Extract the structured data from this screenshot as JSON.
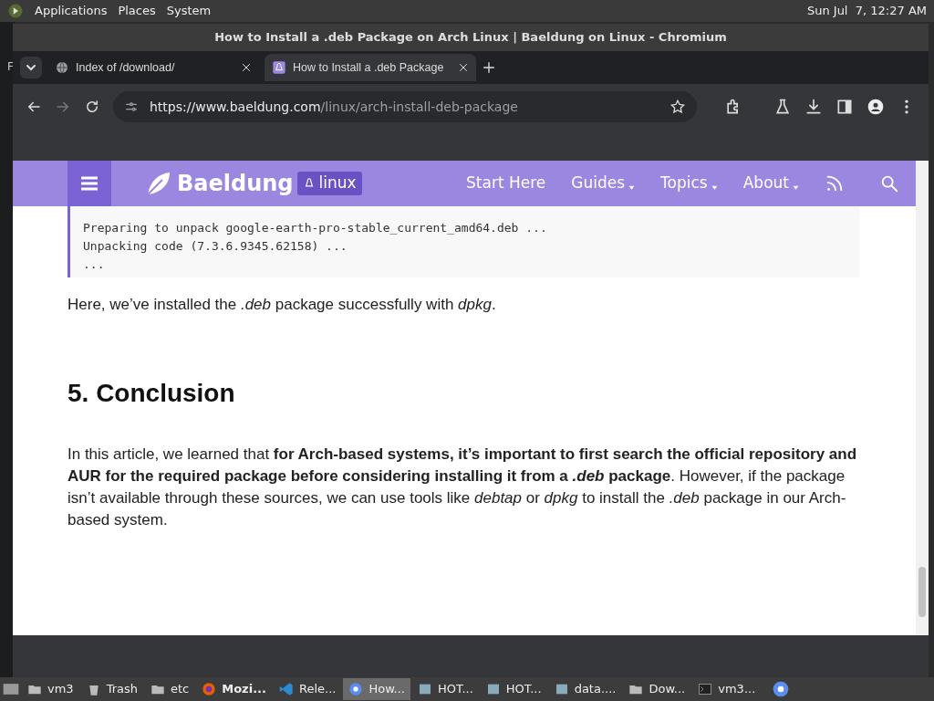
{
  "top_panel": {
    "menus": [
      "Applications",
      "Places",
      "System"
    ],
    "clock": "Sun Jul  7, 12:27 AM"
  },
  "desktop_text": "F",
  "window": {
    "title": "How to Install a .deb Package on Arch Linux | Baeldung on Linux - Chromium"
  },
  "tabs": [
    {
      "label": "Index of /download/",
      "selected": false,
      "kind": "globe"
    },
    {
      "label": "How to Install a .deb Package",
      "selected": true,
      "kind": "penguin"
    }
  ],
  "address": {
    "scheme_host": "https://www.baeldung.com",
    "path": "/linux/arch-install-deb-package"
  },
  "site_nav": {
    "logo": "Baeldung",
    "logo_badge": "linux",
    "links": [
      {
        "label": "Start Here",
        "dropdown": false
      },
      {
        "label": "Guides",
        "dropdown": true
      },
      {
        "label": "Topics",
        "dropdown": true
      },
      {
        "label": "About",
        "dropdown": true
      }
    ]
  },
  "code_lines": [
    "Preparing to unpack google-earth-pro-stable_current_amd64.deb ...",
    "Unpacking code (7.3.6.9345.62158) ...",
    "..."
  ],
  "paragraph_1": "Here, we’ve installed the *.deb* package successfully with *dpkg*.",
  "heading": "5. Conclusion",
  "paragraph_2": [
    {
      "text": "In this article, we learned that ",
      "bold": false,
      "italic": false
    },
    {
      "text": "for Arch-based systems, it’s important to first search the official repository and AUR for the required package before considering installing it from a ",
      "bold": true,
      "italic": false
    },
    {
      "text": ".deb",
      "bold": true,
      "italic": true
    },
    {
      "text": " package",
      "bold": true,
      "italic": false
    },
    {
      "text": ". However, if the package isn’t available through these sources, we can use tools like ",
      "bold": false,
      "italic": false
    },
    {
      "text": "debtap",
      "bold": false,
      "italic": true
    },
    {
      "text": " or ",
      "bold": false,
      "italic": false
    },
    {
      "text": "dpkg",
      "bold": false,
      "italic": true
    },
    {
      "text": " to install the ",
      "bold": false,
      "italic": false
    },
    {
      "text": ".deb",
      "bold": false,
      "italic": true
    },
    {
      "text": " package in our Arch-based system.",
      "bold": false,
      "italic": false
    }
  ],
  "taskbar": [
    {
      "label": "vm3",
      "kind": "folder",
      "selected": false
    },
    {
      "label": "Trash",
      "kind": "trash",
      "selected": false
    },
    {
      "label": "etc",
      "kind": "folder",
      "selected": false
    },
    {
      "label": "Mozi...",
      "kind": "firefox",
      "selected": false
    },
    {
      "label": "Rele...",
      "kind": "code",
      "selected": false
    },
    {
      "label": "How...",
      "kind": "chromium",
      "selected": true
    },
    {
      "label": "HOT...",
      "kind": "app",
      "selected": false
    },
    {
      "label": "HOT...",
      "kind": "app",
      "selected": false
    },
    {
      "label": "data....",
      "kind": "app",
      "selected": false
    },
    {
      "label": "Dow...",
      "kind": "folder",
      "selected": false
    },
    {
      "label": "vm3...",
      "kind": "terminal",
      "selected": false
    }
  ]
}
